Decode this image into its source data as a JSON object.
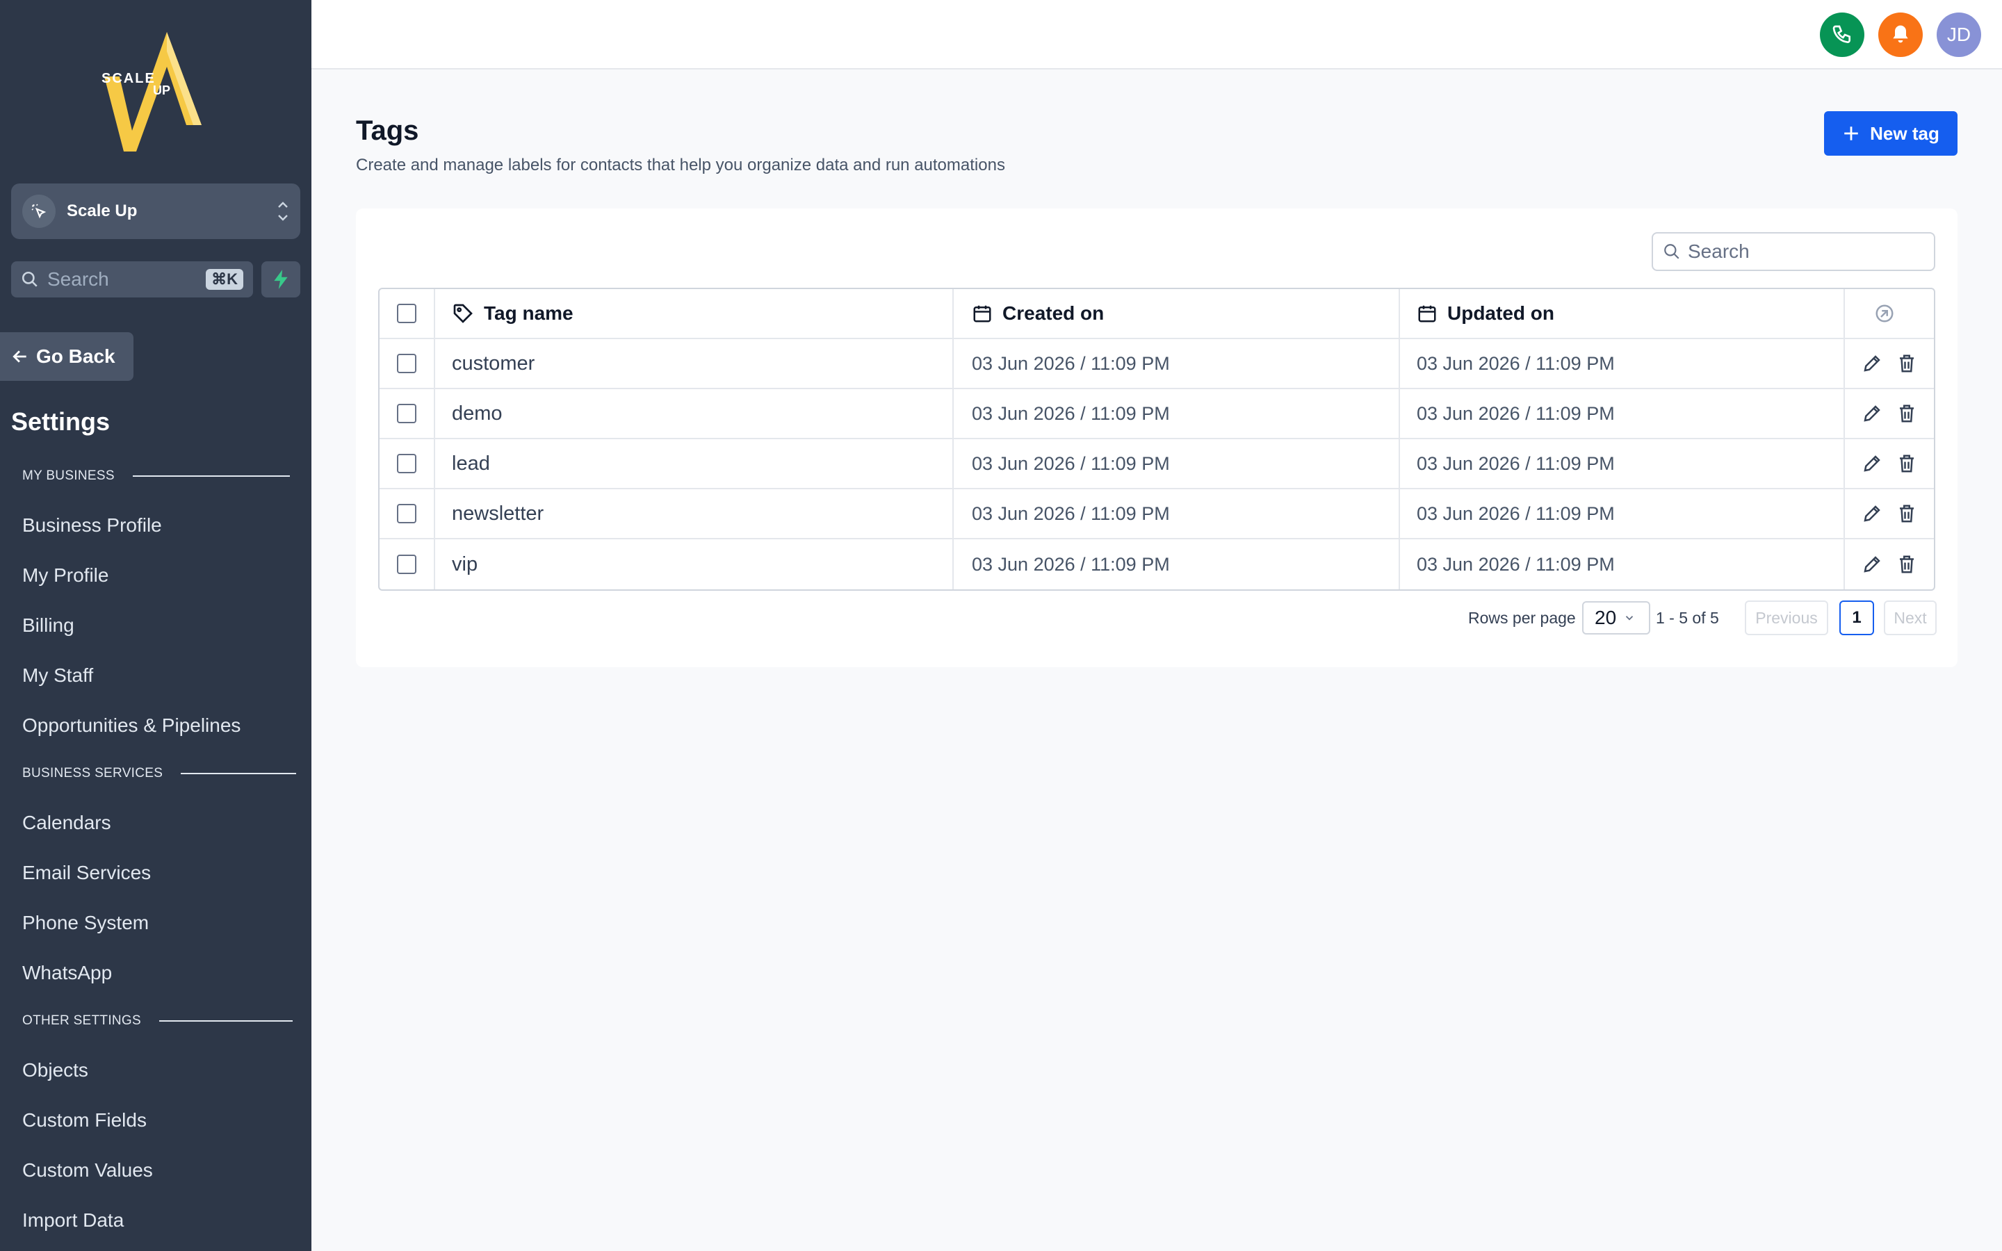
{
  "colors": {
    "sidebar_bg": "#2d3748",
    "primary": "#155eef",
    "phone_green": "#079455",
    "bell_orange": "#f97316",
    "avatar_purple": "#8892d6",
    "logo_yellow": "#f6c945"
  },
  "sidebar": {
    "logo_text_top": "SCALE",
    "logo_text_bottom": "UP",
    "location_name": "Scale Up",
    "search_placeholder": "Search",
    "search_shortcut": "⌘K",
    "go_back_label": "Go Back",
    "settings_title": "Settings",
    "sections": [
      {
        "label": "MY BUSINESS",
        "items": [
          "Business Profile",
          "My Profile",
          "Billing",
          "My Staff",
          "Opportunities & Pipelines"
        ]
      },
      {
        "label": "BUSINESS SERVICES",
        "items": [
          "Calendars",
          "Email Services",
          "Phone System",
          "WhatsApp"
        ]
      },
      {
        "label": "OTHER SETTINGS",
        "items": [
          "Objects",
          "Custom Fields",
          "Custom Values",
          "Import Data"
        ]
      }
    ]
  },
  "header": {
    "avatar_initials": "JD",
    "icons": [
      "phone-icon",
      "bell-icon"
    ]
  },
  "main": {
    "title": "Tags",
    "subtitle": "Create and manage labels for contacts that help you organize data and run automations",
    "new_tag_label": "New tag",
    "search_placeholder": "Search",
    "table": {
      "columns": [
        "Tag name",
        "Created on",
        "Updated on"
      ],
      "rows": [
        {
          "name": "customer",
          "created": "03 Jun 2026 / 11:09 PM",
          "updated": "03 Jun 2026 / 11:09 PM"
        },
        {
          "name": "demo",
          "created": "03 Jun 2026 / 11:09 PM",
          "updated": "03 Jun 2026 / 11:09 PM"
        },
        {
          "name": "lead",
          "created": "03 Jun 2026 / 11:09 PM",
          "updated": "03 Jun 2026 / 11:09 PM"
        },
        {
          "name": "newsletter",
          "created": "03 Jun 2026 / 11:09 PM",
          "updated": "03 Jun 2026 / 11:09 PM"
        },
        {
          "name": "vip",
          "created": "03 Jun 2026 / 11:09 PM",
          "updated": "03 Jun 2026 / 11:09 PM"
        }
      ]
    },
    "pagination": {
      "rows_per_page_label": "Rows per page",
      "rows_per_page": "20",
      "range": "1 - 5 of 5",
      "previous_label": "Previous",
      "current_page": "1",
      "next_label": "Next"
    }
  }
}
